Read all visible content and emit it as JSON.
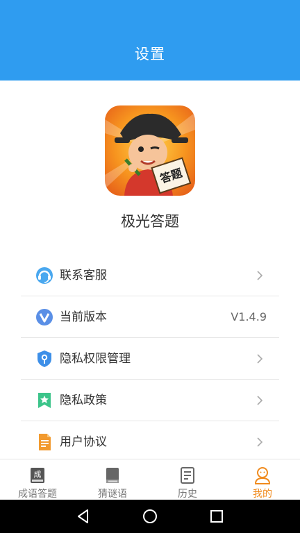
{
  "header": {
    "title": "设置"
  },
  "app": {
    "name": "极光答题",
    "logo_text": "答题"
  },
  "menu": {
    "items": [
      {
        "label": "联系客服",
        "icon": "customer-service-icon"
      },
      {
        "label": "当前版本",
        "icon": "version-icon",
        "value": "V1.4.9"
      },
      {
        "label": "隐私权限管理",
        "icon": "privacy-permission-icon"
      },
      {
        "label": "隐私政策",
        "icon": "privacy-policy-icon"
      },
      {
        "label": "用户协议",
        "icon": "user-agreement-icon"
      }
    ]
  },
  "tabbar": {
    "tabs": [
      {
        "label": "成语答题",
        "icon": "idiom-icon",
        "icon_text": "成"
      },
      {
        "label": "猜谜语",
        "icon": "book-icon"
      },
      {
        "label": "历史",
        "icon": "history-icon"
      },
      {
        "label": "我的",
        "icon": "profile-icon",
        "active": true
      }
    ]
  },
  "colors": {
    "header": "#2f9cf0",
    "active_tab": "#f08a1c",
    "text": "#333333"
  }
}
